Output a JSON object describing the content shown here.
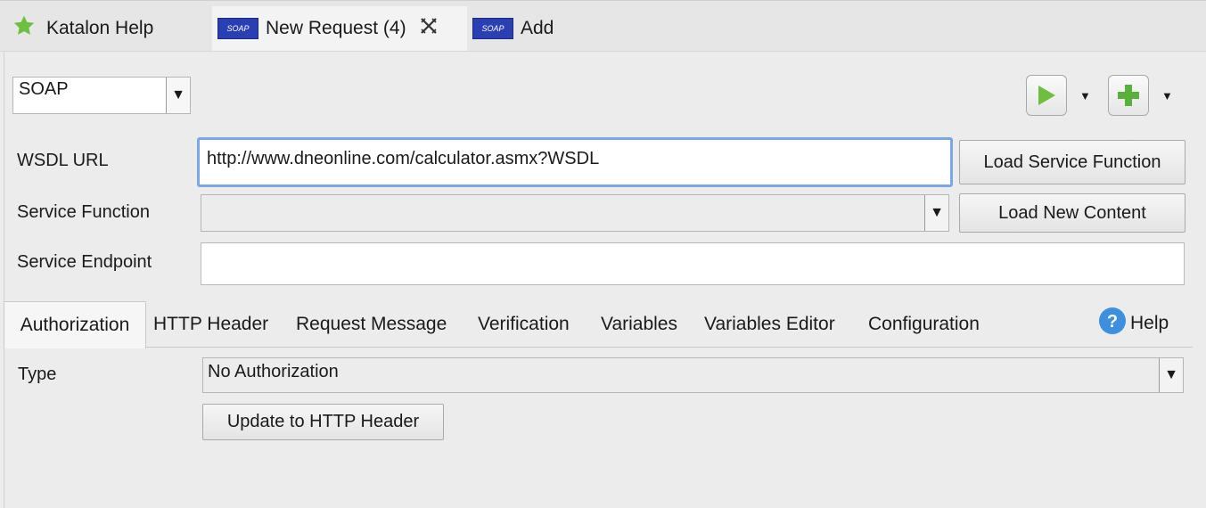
{
  "editor_tabs": [
    {
      "label": "Katalon Help",
      "icon": "star-icon"
    },
    {
      "label": "New Request (4)",
      "icon": "soap-icon",
      "active": true
    },
    {
      "label": "Add",
      "icon": "soap-icon"
    }
  ],
  "soap_icon_text": "SOAP",
  "request_type": "SOAP",
  "wsdl": {
    "label": "WSDL URL",
    "value": "http://www.dneonline.com/calculator.asmx?WSDL"
  },
  "load_service_function": "Load Service Function",
  "service_function": {
    "label": "Service Function",
    "value": ""
  },
  "load_new_content": "Load New Content",
  "service_endpoint": {
    "label": "Service Endpoint",
    "value": ""
  },
  "sub_tabs": [
    "Authorization",
    "HTTP Header",
    "Request Message",
    "Verification",
    "Variables",
    "Variables Editor",
    "Configuration"
  ],
  "help_label": "Help",
  "auth": {
    "type_label": "Type",
    "type_value": "No Authorization",
    "update_button": "Update to HTTP Header"
  },
  "colors": {
    "accent": "#7aa7e6",
    "play_green": "#6cbf3f",
    "help_blue": "#3d8fe0"
  }
}
